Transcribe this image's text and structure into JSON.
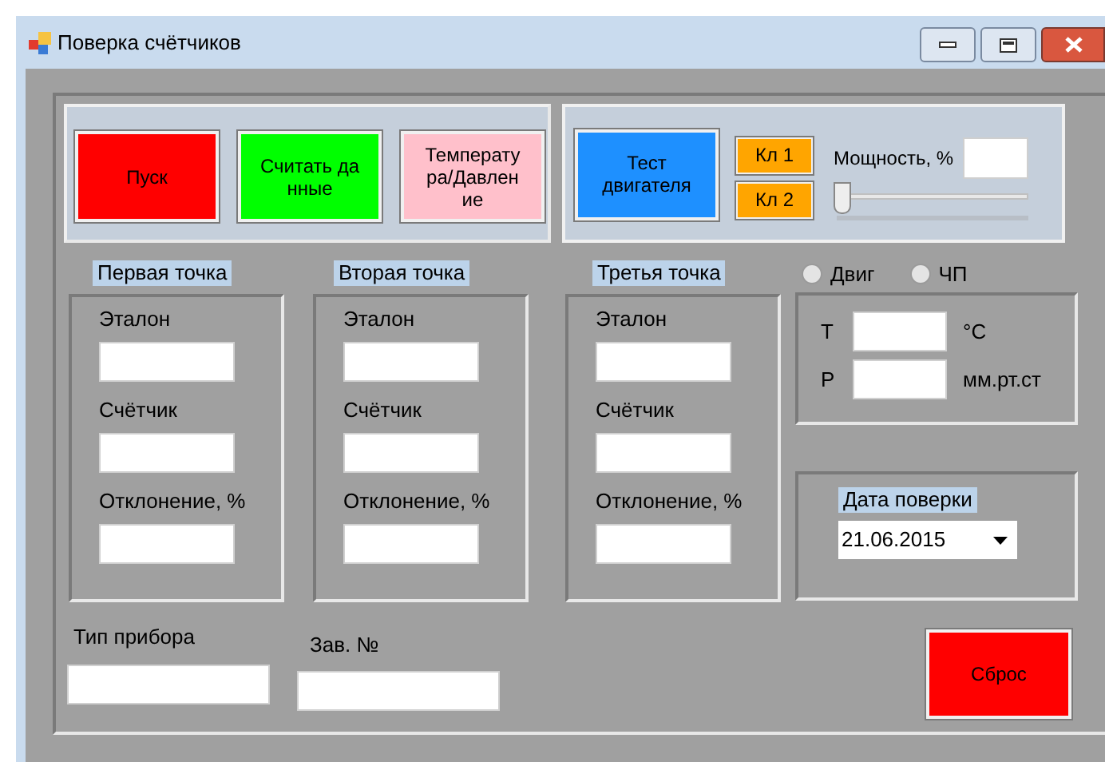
{
  "window": {
    "title": "Поверка счётчиков"
  },
  "left_buttons": [
    {
      "label": "Пуск",
      "color": "#ff0000"
    },
    {
      "label": "Считать данные",
      "color": "#00ff00"
    },
    {
      "label": "Температура/Давление",
      "color": "#ffc0cb"
    }
  ],
  "engine_button": {
    "label": "Тест двигателя",
    "color": "#1e90ff"
  },
  "valve_buttons": [
    {
      "label": "Кл 1"
    },
    {
      "label": "Кл 2"
    }
  ],
  "power": {
    "label": "Мощность, %",
    "level": 0
  },
  "points": [
    {
      "title": "Первая точка",
      "fields": [
        {
          "label": "Эталон"
        },
        {
          "label": "Счётчик"
        },
        {
          "label": "Отклонение, %"
        }
      ]
    },
    {
      "title": "Вторая точка",
      "fields": [
        {
          "label": "Эталон"
        },
        {
          "label": "Счётчик"
        },
        {
          "label": "Отклонение, %"
        }
      ]
    },
    {
      "title": "Третья точка",
      "fields": [
        {
          "label": "Эталон"
        },
        {
          "label": "Счётчик"
        },
        {
          "label": "Отклонение, %"
        }
      ]
    }
  ],
  "modes": [
    {
      "label": "Двиг",
      "selected": false
    },
    {
      "label": "ЧП",
      "selected": false
    }
  ],
  "conditions": [
    {
      "label": "T",
      "unit": "°C"
    },
    {
      "label": "P",
      "unit": "мм.рт.ст"
    }
  ],
  "date_group": {
    "title": "Дата поверки",
    "value": "21.06.2015"
  },
  "device_type": {
    "label": "Тип прибора"
  },
  "serial": {
    "label": "Зав. №"
  },
  "reset_button": {
    "label": "Сброс",
    "color": "#ff0000"
  }
}
